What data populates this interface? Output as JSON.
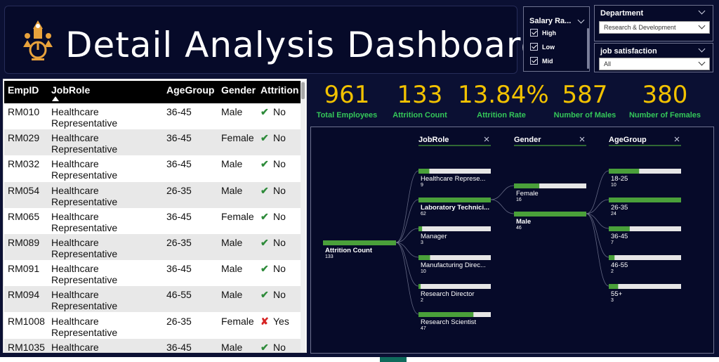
{
  "title": "Detail Analysis Dashboard",
  "colors": {
    "accent_gold": "#f2c200",
    "accent_green": "#34c759",
    "bar_green": "#4aa03a",
    "background": "#0b1033",
    "panel": "#060a29"
  },
  "salary_slicer": {
    "title": "Salary Ra...",
    "options": [
      {
        "label": "High",
        "checked": true
      },
      {
        "label": "Low",
        "checked": true
      },
      {
        "label": "Mid",
        "checked": true
      }
    ]
  },
  "department_slicer": {
    "title": "Department",
    "value": "Research & Development"
  },
  "job_satisfaction_slicer": {
    "title": "job satisfaction",
    "value": "All"
  },
  "table": {
    "columns": [
      "EmpID",
      "JobRole",
      "AgeGroup",
      "Gender",
      "Attrition"
    ],
    "rows": [
      {
        "empid": "RM010",
        "role_l1": "Healthcare",
        "role_l2": "Representative",
        "age": "36-45",
        "gender": "Male",
        "attrition": "No"
      },
      {
        "empid": "RM029",
        "role_l1": "Healthcare",
        "role_l2": "Representative",
        "age": "36-45",
        "gender": "Female",
        "attrition": "No"
      },
      {
        "empid": "RM032",
        "role_l1": "Healthcare",
        "role_l2": "Representative",
        "age": "36-45",
        "gender": "Male",
        "attrition": "No"
      },
      {
        "empid": "RM054",
        "role_l1": "Healthcare",
        "role_l2": "Representative",
        "age": "26-35",
        "gender": "Male",
        "attrition": "No"
      },
      {
        "empid": "RM065",
        "role_l1": "Healthcare",
        "role_l2": "Representative",
        "age": "36-45",
        "gender": "Female",
        "attrition": "No"
      },
      {
        "empid": "RM089",
        "role_l1": "Healthcare",
        "role_l2": "Representative",
        "age": "26-35",
        "gender": "Male",
        "attrition": "No"
      },
      {
        "empid": "RM091",
        "role_l1": "Healthcare",
        "role_l2": "Representative",
        "age": "36-45",
        "gender": "Male",
        "attrition": "No"
      },
      {
        "empid": "RM094",
        "role_l1": "Healthcare",
        "role_l2": "Representative",
        "age": "46-55",
        "gender": "Male",
        "attrition": "No"
      },
      {
        "empid": "RM1008",
        "role_l1": "Healthcare",
        "role_l2": "Representative",
        "age": "26-35",
        "gender": "Female",
        "attrition": "Yes"
      },
      {
        "empid": "RM1035",
        "role_l1": "Healthcare",
        "role_l2": "",
        "age": "36-45",
        "gender": "Male",
        "attrition": "No"
      }
    ]
  },
  "kpis": [
    {
      "value": "961",
      "label": "Total Employees"
    },
    {
      "value": "133",
      "label": "Attrition Count"
    },
    {
      "value": "13.84%",
      "label": "Attrition Rate"
    },
    {
      "value": "587",
      "label": "Number of Males"
    },
    {
      "value": "380",
      "label": "Number of Females"
    }
  ],
  "decomposition_tree": {
    "root": {
      "label": "Attrition Count",
      "value": "133"
    },
    "levels": [
      {
        "header": "JobRole",
        "nodes": [
          {
            "label": "Healthcare Represe...",
            "value": "9",
            "fraction": 0.15
          },
          {
            "label": "Laboratory Technici...",
            "value": "62",
            "fraction": 1.0,
            "selected": true
          },
          {
            "label": "Manager",
            "value": "3",
            "fraction": 0.05
          },
          {
            "label": "Manufacturing Direc...",
            "value": "10",
            "fraction": 0.16
          },
          {
            "label": "Research Director",
            "value": "2",
            "fraction": 0.03
          },
          {
            "label": "Research Scientist",
            "value": "47",
            "fraction": 0.76
          }
        ]
      },
      {
        "header": "Gender",
        "nodes": [
          {
            "label": "Female",
            "value": "16",
            "fraction": 0.35
          },
          {
            "label": "Male",
            "value": "46",
            "fraction": 1.0,
            "selected": true
          }
        ]
      },
      {
        "header": "AgeGroup",
        "nodes": [
          {
            "label": "18-25",
            "value": "10",
            "fraction": 0.42
          },
          {
            "label": "26-35",
            "value": "24",
            "fraction": 1.0
          },
          {
            "label": "36-45",
            "value": "7",
            "fraction": 0.29
          },
          {
            "label": "46-55",
            "value": "2",
            "fraction": 0.08
          },
          {
            "label": "55+",
            "value": "3",
            "fraction": 0.13
          }
        ]
      }
    ]
  }
}
